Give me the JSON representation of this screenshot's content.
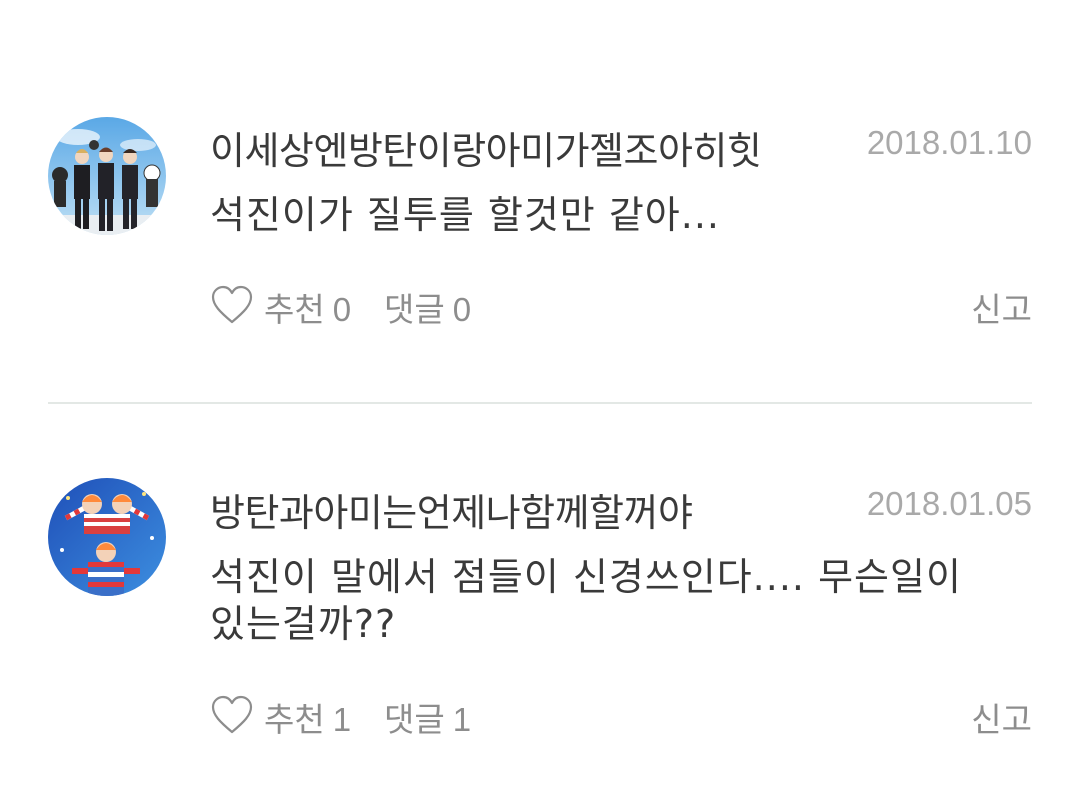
{
  "comments": [
    {
      "username": "이세상엔방탄이랑아미가젤조아히힛",
      "date": "2018.01.10",
      "text": "석진이가 질투를 할것만 같아...",
      "like_label": "추천",
      "like_count": "0",
      "reply_label": "댓글",
      "reply_count": "0",
      "report_label": "신고"
    },
    {
      "username": "방탄과아미는언제나함께할꺼야",
      "date": "2018.01.05",
      "text": "석진이 말에서 점들이 신경쓰인다.... 무슨일이 있는걸까??",
      "like_label": "추천",
      "like_count": "1",
      "reply_label": "댓글",
      "reply_count": "1",
      "report_label": "신고"
    }
  ],
  "icons": {
    "like": "heart-outline-icon"
  },
  "colors": {
    "text": "#3a3a3a",
    "muted": "#8d8d8d",
    "date": "#a9a9a9",
    "divider": "#e3e8e5"
  }
}
